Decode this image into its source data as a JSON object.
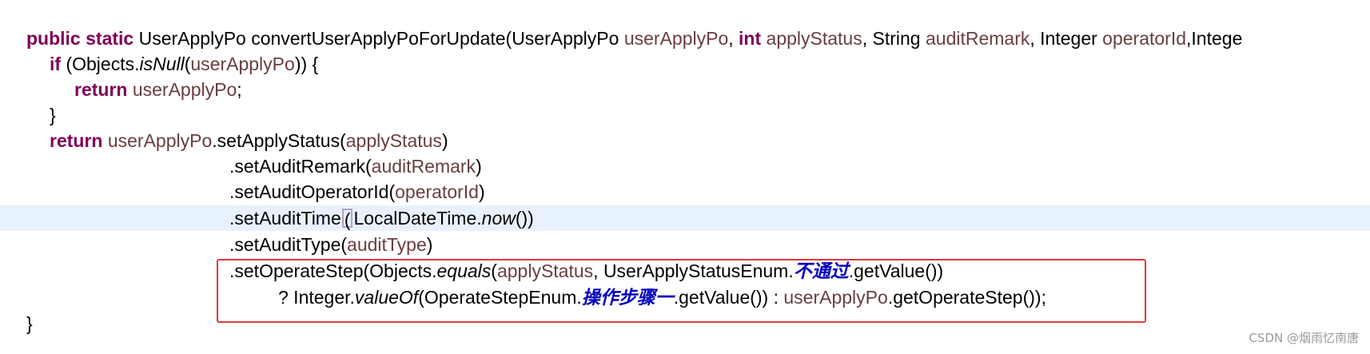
{
  "code": {
    "l1": {
      "kw_public": "public",
      "kw_static": "static",
      "t1": " UserApplyPo convertUserApplyPoForUpdate(UserApplyPo ",
      "v1": "userApplyPo",
      "t2": ", ",
      "kw_int": "int",
      "t3": " ",
      "v2": "applyStatus",
      "t4": ", String ",
      "v3": "auditRemark",
      "t5": ", Integer ",
      "v4": "operatorId",
      "t6": ",Intege"
    },
    "l2": {
      "kw_if": "if",
      "t1": " (Objects.",
      "m1": "isNull",
      "t2": "(",
      "v1": "userApplyPo",
      "t3": ")) {"
    },
    "l3": {
      "kw_return": "return",
      "t1": " ",
      "v1": "userApplyPo",
      "t2": ";"
    },
    "l4": {
      "t1": "}"
    },
    "l5": {
      "kw_return": "return",
      "t1": " ",
      "v1": "userApplyPo",
      "t2": ".setApplyStatus(",
      "v2": "applyStatus",
      "t3": ")"
    },
    "l6": {
      "t1": ".setAuditRemark(",
      "v1": "auditRemark",
      "t2": ")"
    },
    "l7": {
      "t1": ".setAuditOperatorId(",
      "v1": "operatorId",
      "t2": ")"
    },
    "l8": {
      "t1": ".setAuditTime",
      "caret_paren": "(",
      "t2": "LocalDateTime.",
      "m1": "now",
      "t3": "())"
    },
    "l9": {
      "t1": ".setAuditType(",
      "v1": "auditType",
      "t2": ")"
    },
    "l10": {
      "t1": ".setOperateStep(Objects.",
      "m1": "equals",
      "t2": "(",
      "v1": "applyStatus",
      "t3": ", UserApplyStatusEnum.",
      "f1": "不通过",
      "t4": ".getValue())"
    },
    "l11": {
      "t1": "? Integer.",
      "m1": "valueOf",
      "t2": "(OperateStepEnum.",
      "f1": "操作步骤一",
      "t3": ".getValue()) : ",
      "v1": "userApplyPo",
      "t4": ".getOperateStep());"
    },
    "l12": {
      "t1": "}"
    }
  },
  "watermark": "CSDN @烟雨忆南唐",
  "colors": {
    "keyword": "#7f0055",
    "variable": "#6a3e3e",
    "enum_field": "#0000c0",
    "highlight_line": "#e8f2fe",
    "annotation_box": "#e03a3a"
  }
}
